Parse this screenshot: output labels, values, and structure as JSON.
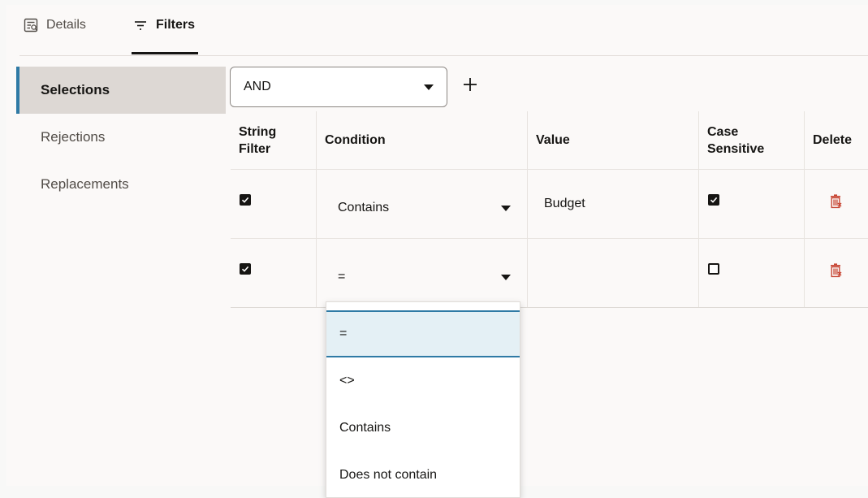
{
  "tabs": [
    {
      "label": "Details",
      "icon": "details-icon",
      "active": false
    },
    {
      "label": "Filters",
      "icon": "filter-icon",
      "active": true
    }
  ],
  "sidebar": {
    "items": [
      {
        "label": "Selections",
        "active": true
      },
      {
        "label": "Rejections",
        "active": false
      },
      {
        "label": "Replacements",
        "active": false
      }
    ]
  },
  "operator": {
    "value": "AND",
    "add_icon": "plus-icon"
  },
  "table": {
    "headers": {
      "string_filter": "String Filter",
      "condition": "Condition",
      "value": "Value",
      "case_sensitive": "Case Sensitive",
      "delete": "Delete"
    },
    "rows": [
      {
        "string_filter": true,
        "condition": "Contains",
        "value": "Budget",
        "case_sensitive": true
      },
      {
        "string_filter": true,
        "condition": "=",
        "value": "",
        "case_sensitive": false
      }
    ]
  },
  "dropdown": {
    "options": [
      "=",
      "<>",
      "Contains",
      "Does not contain"
    ],
    "selected": "="
  },
  "colors": {
    "accent": "#2f7aa5",
    "delete_icon": "#c74634",
    "selected_bg": "#e4f0f5",
    "sidebar_active_bg": "#ddd8d4"
  }
}
